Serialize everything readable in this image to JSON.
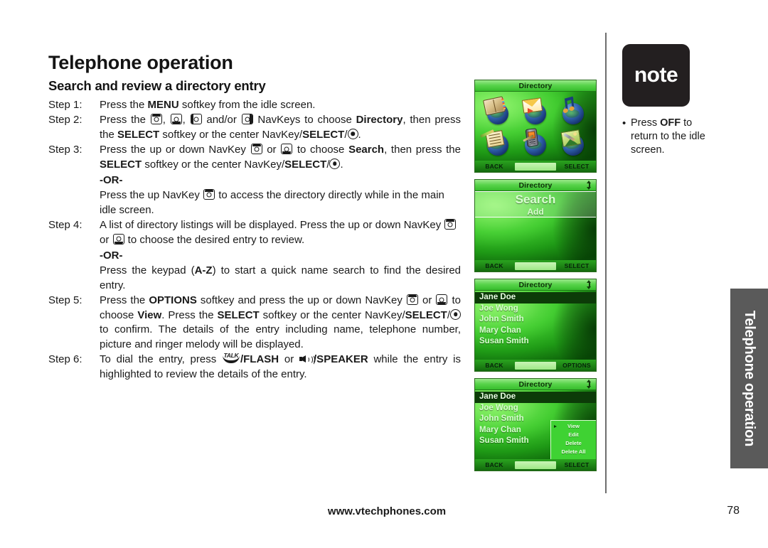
{
  "document": {
    "chapter_title": "Telephone operation",
    "section_title": "Search and review a directory entry",
    "side_tab": "Telephone operation",
    "footer_url": "www.vtechphones.com",
    "page_number": "78"
  },
  "steps": [
    {
      "label": "Step 1:",
      "id": "step-1"
    },
    {
      "label": "Step 2:",
      "id": "step-2"
    },
    {
      "label": "Step 3:",
      "id": "step-3"
    },
    {
      "label": "Step 4:",
      "id": "step-4"
    },
    {
      "label": "Step 5:",
      "id": "step-5"
    },
    {
      "label": "Step 6:",
      "id": "step-6"
    }
  ],
  "text": {
    "step1": "Press the ",
    "step1_menu": "MENU",
    "step1_rest": " softkey from the idle screen.",
    "step2_a": "Press the ",
    "step2_b": ", ",
    "step2_c": ", ",
    "step2_d": " and/or ",
    "step2_e": " NavKeys to choose ",
    "step2_directory": "Directory",
    "step2_f": ", then press the ",
    "step2_select": "SELECT",
    "step2_g": " softkey or the center NavKey/",
    "step2_select2": "SELECT",
    "step2_h": "/",
    "step2_i": ".",
    "step3_a": "Press the up or down NavKey ",
    "step3_b": " or ",
    "step3_c": " to choose ",
    "step3_search": "Search",
    "step3_d": ", then press the ",
    "step3_select": "SELECT",
    "step3_e": " softkey or the center NavKey/",
    "step3_select2": "SELECT",
    "step3_f": "/",
    "step3_g": ".",
    "or_label": "-OR-",
    "step3_or_a": "Press the up NavKey ",
    "step3_or_b": " to access the directory directly while in the main idle screen.",
    "step4_a": "A list of directory listings will be displayed. Press the up or down NavKey ",
    "step4_b": " or ",
    "step4_c": " to choose the desired entry to review.",
    "step4_or_a": "Press the keypad (",
    "step4_or_az": "A-Z",
    "step4_or_b": ") to start a quick name search to find the desired entry.",
    "step5_a": "Press the ",
    "step5_options": "OPTIONS",
    "step5_b": " softkey and press the up or down NavKey ",
    "step5_c": " or ",
    "step5_d": " to choose ",
    "step5_view": "View",
    "step5_e": ". Press the ",
    "step5_select": "SELECT",
    "step5_f": " softkey or the center NavKey/",
    "step5_select2": "SELECT",
    "step5_g": "/",
    "step5_h": " to confirm. The details of the entry including name, telephone number, picture and ringer melody will be displayed.",
    "step6_a": "To dial the entry, press ",
    "step6_flash": "/FLASH",
    "step6_b": " or ",
    "step6_speaker": "/SPEAKER",
    "step6_c": " while the entry is highlighted to review the details of the entry."
  },
  "note": {
    "badge_label": "note",
    "bullet": "•",
    "text_a": "Press ",
    "text_off": "OFF",
    "text_b": " to return to the idle screen."
  },
  "phone_screens": [
    {
      "id": "screen-directory-menu",
      "title": "Directory",
      "has_scroll_indicator": false,
      "softkey_left": "BACK",
      "softkey_right": "SELECT",
      "icons": [
        "directory-book-icon",
        "envelope-mail-icon",
        "music-note-icon",
        "notepad-pencil-icon",
        "phone-handset-icon",
        "picture-settings-icon"
      ]
    },
    {
      "id": "screen-directory-submenu",
      "title": "Directory",
      "has_scroll_indicator": true,
      "softkey_left": "BACK",
      "softkey_right": "SELECT",
      "items": [
        "Search",
        "Add"
      ],
      "highlighted": "Search"
    },
    {
      "id": "screen-directory-list",
      "title": "Directory",
      "has_scroll_indicator": true,
      "softkey_left": "BACK",
      "softkey_right": "OPTIONS",
      "entries": [
        "Jane Doe",
        "Joe Wong",
        "John Smith",
        "Mary Chan",
        "Susan Smith"
      ],
      "highlighted": "Jane Doe"
    },
    {
      "id": "screen-directory-options",
      "title": "Directory",
      "has_scroll_indicator": true,
      "softkey_left": "BACK",
      "softkey_right": "SELECT",
      "entries": [
        "Jane Doe",
        "Joe Wong",
        "John Smith",
        "Mary Chan",
        "Susan Smith"
      ],
      "highlighted": "Jane Doe",
      "popup_menu": [
        "View",
        "Edit",
        "Delete",
        "Delete All"
      ],
      "popup_selected": "View"
    }
  ],
  "colors": {
    "screen_green": "#2ecc2e",
    "screen_dark_green": "#0b5a08",
    "title_bar_green": "#57d34a",
    "note_badge_bg": "#231f20",
    "side_tab_bg": "#5a5a5a",
    "text_black": "#1a1a1a"
  }
}
